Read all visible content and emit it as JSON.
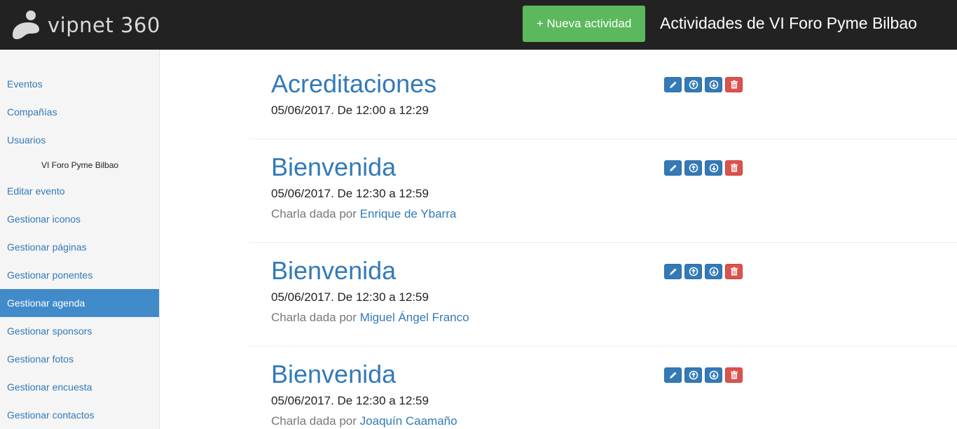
{
  "header": {
    "logo_text": "vipnet 360",
    "new_button": "+ Nueva actividad",
    "title": "Actividades de VI Foro Pyme Bilbao"
  },
  "sidebar": {
    "items": [
      {
        "label": "Eventos"
      },
      {
        "label": "Compañías"
      },
      {
        "label": "Usuarios"
      },
      {
        "label": "Editar evento"
      },
      {
        "label": "Gestionar iconos"
      },
      {
        "label": "Gestionar páginas"
      },
      {
        "label": "Gestionar ponentes"
      },
      {
        "label": "Gestionar agenda",
        "active": true
      },
      {
        "label": "Gestionar sponsors"
      },
      {
        "label": "Gestionar fotos"
      },
      {
        "label": "Gestionar encuesta"
      },
      {
        "label": "Gestionar contactos"
      }
    ],
    "current_event": "VI Foro Pyme Bilbao"
  },
  "activities": [
    {
      "title": "Acreditaciones",
      "datetime": "05/06/2017. De 12:00 a 12:29"
    },
    {
      "title": "Bienvenida",
      "datetime": "05/06/2017. De 12:30 a 12:59",
      "speaker_prefix": "Charla dada por",
      "speaker": "Enrique de Ybarra"
    },
    {
      "title": "Bienvenida",
      "datetime": "05/06/2017. De 12:30 a 12:59",
      "speaker_prefix": "Charla dada por",
      "speaker": "Miguel Ángel Franco"
    },
    {
      "title": "Bienvenida",
      "datetime": "05/06/2017. De 12:30 a 12:59",
      "speaker_prefix": "Charla dada por",
      "speaker": "Joaquín Caamaño"
    }
  ],
  "action_icons": [
    "pencil-icon",
    "arrow-up-icon",
    "arrow-down-icon",
    "trash-icon"
  ],
  "colors": {
    "header_bg": "#222222",
    "new_button": "#5cb85c",
    "link": "#337ab7",
    "active_nav": "#428bca",
    "danger": "#d9534f"
  }
}
